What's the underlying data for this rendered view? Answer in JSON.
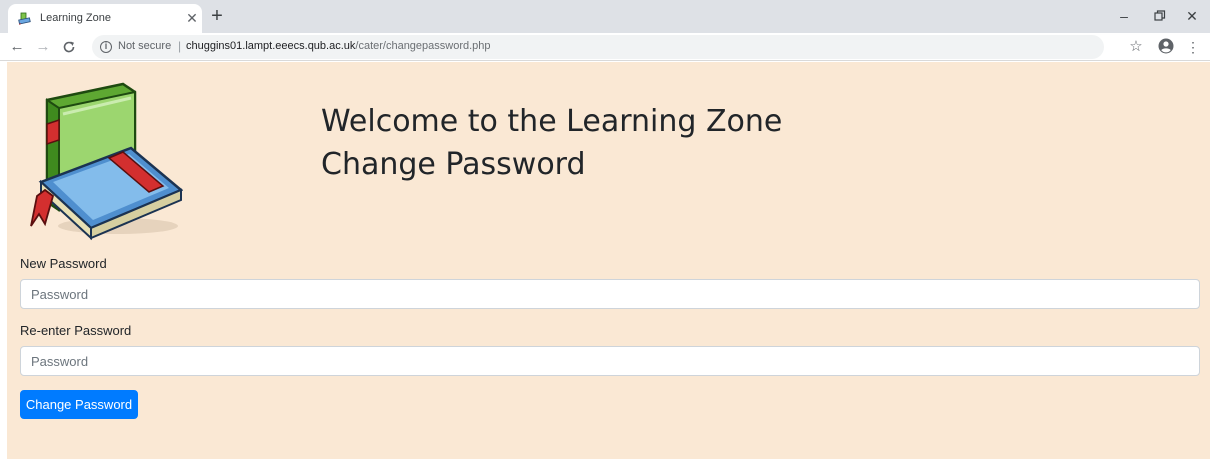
{
  "browser": {
    "tab": {
      "title": "Learning Zone",
      "close_icon": "close-icon",
      "favicon": "learning-zone-favicon"
    },
    "new_tab_icon": "plus-icon",
    "window_controls": {
      "minimize": "–",
      "restore": "⧉",
      "close": "✕"
    },
    "nav": {
      "back": "←",
      "forward": "→",
      "reload": "C"
    },
    "address_bar": {
      "security_label": "Not secure",
      "url_host": "chuggins01.lampt.eeecs.qub.ac.uk",
      "url_path": "/cater/changepassword.php"
    }
  },
  "page": {
    "logo": "books-icon",
    "heading_line1": "Welcome to the Learning Zone",
    "heading_line2": "Change Password",
    "form": {
      "new_password_label": "New Password",
      "new_password_placeholder": "Password",
      "new_password_value": "",
      "reenter_password_label": "Re-enter Password",
      "reenter_password_placeholder": "Password",
      "reenter_password_value": "",
      "submit_label": "Change Password"
    },
    "colors": {
      "background": "#fae8d4",
      "primary_button": "#007bff"
    }
  }
}
